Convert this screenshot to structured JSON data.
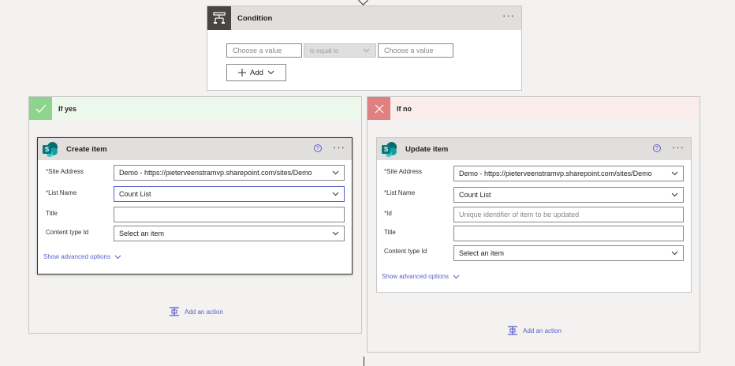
{
  "condition": {
    "title": "Condition",
    "left_placeholder": "Choose a value",
    "operator": "is equal to",
    "right_placeholder": "Choose a value",
    "add_label": "Add"
  },
  "branches": {
    "yes": {
      "label": "If yes",
      "action": {
        "title": "Create item",
        "fields": {
          "site_label": "Site Address",
          "site_value": "Demo - https://pieterveenstramvp.sharepoint.com/sites/Demo",
          "list_label": "List Name",
          "list_value": "Count List",
          "title_label": "Title",
          "ctype_label": "Content type Id",
          "ctype_value": "Select an item"
        },
        "advanced": "Show advanced options"
      },
      "add_action": "Add an action"
    },
    "no": {
      "label": "If no",
      "action": {
        "title": "Update item",
        "fields": {
          "site_label": "Site Address",
          "site_value": "Demo - https://pieterveenstramvp.sharepoint.com/sites/Demo",
          "list_label": "List Name",
          "list_value": "Count List",
          "id_label": "Id",
          "id_placeholder": "Unique identifier of item to be updated",
          "title_label": "Title",
          "ctype_label": "Content type Id",
          "ctype_value": "Select an item"
        },
        "advanced": "Show advanced options"
      },
      "add_action": "Add an action"
    }
  },
  "icons": {
    "condition": "condition-icon",
    "yes": "checkmark-icon",
    "no": "close-icon",
    "sharepoint": "sharepoint-icon",
    "help": "help-icon",
    "more": "more-icon",
    "chevron": "chevron-down-icon",
    "add_action": "add-action-icon"
  },
  "colors": {
    "accent": "#5b5fc7",
    "yes": "#8ed48d",
    "no": "#e08080",
    "required": "#a4262c"
  }
}
